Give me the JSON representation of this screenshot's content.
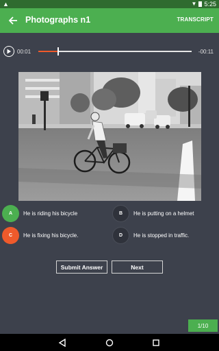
{
  "status_bar": {
    "time": "5:25",
    "notification_icon": "notification-icon"
  },
  "app_bar": {
    "title": "Photographs n1",
    "transcript_label": "TRANSCRIPT",
    "back_icon": "arrow-back-icon"
  },
  "player": {
    "current_time": "00:01",
    "remaining_time": "-00:11",
    "progress": 0.13
  },
  "photo": {
    "description_icon": "street-photo-icon"
  },
  "choices": [
    {
      "letter": "A",
      "text": "He is riding his bicycle"
    },
    {
      "letter": "B",
      "text": "He is putting on a helmet"
    },
    {
      "letter": "C",
      "text": "He is fixing his bicycle."
    },
    {
      "letter": "D",
      "text": "He is stopped in traffic."
    }
  ],
  "buttons": {
    "submit": "Submit Answer",
    "next": "Next"
  },
  "page_indicator": "1/10",
  "colors": {
    "accent_green": "#4caf50",
    "accent_orange": "#ef5a2b",
    "background": "#3d414c",
    "status_bar": "#2f6b2f"
  }
}
